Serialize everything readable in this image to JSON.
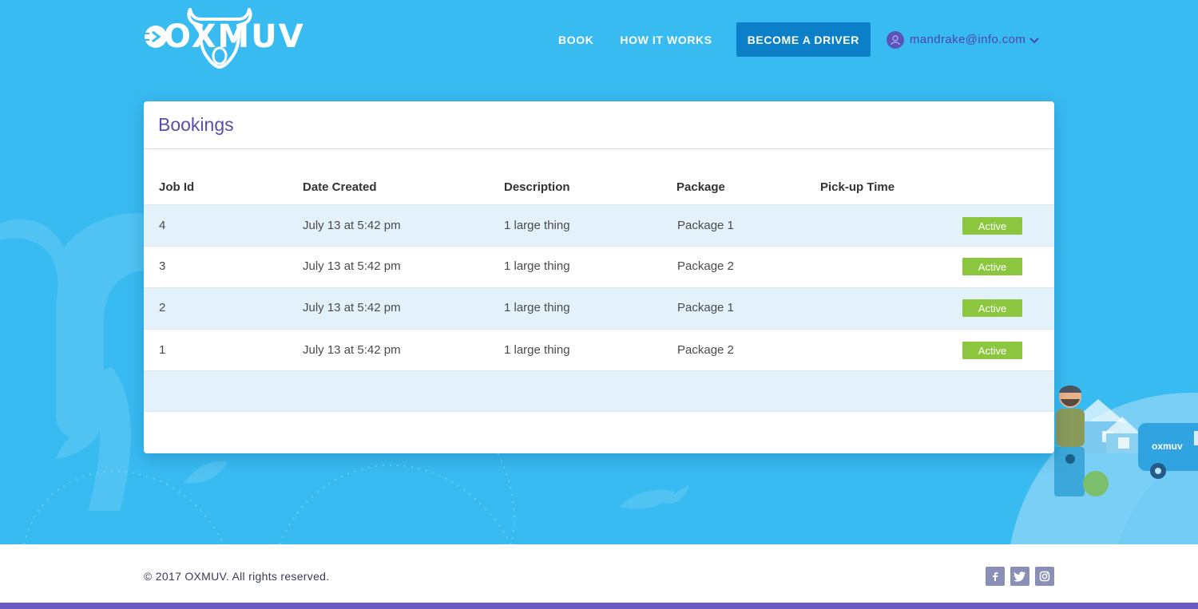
{
  "header": {
    "logo_text": "OXMUV",
    "nav": [
      "BOOK",
      "HOW IT WORKS"
    ],
    "driver_button": "BECOME A DRIVER",
    "user_email": "mandrake@info.com"
  },
  "bookings": {
    "title": "Bookings",
    "columns": [
      "Job Id",
      "Date Created",
      "Description",
      "Package",
      "Pick-up Time"
    ],
    "rows": [
      {
        "id": "4",
        "date": "July 13 at 5:42 pm",
        "description": "1 large thing",
        "package": "Package 1",
        "pickup": "",
        "status": "Active"
      },
      {
        "id": "3",
        "date": "July 13 at 5:42 pm",
        "description": "1 large thing",
        "package": "Package 2",
        "pickup": "",
        "status": "Active"
      },
      {
        "id": "2",
        "date": "July 13 at 5:42 pm",
        "description": "1 large thing",
        "package": "Package 1",
        "pickup": "",
        "status": "Active"
      },
      {
        "id": "1",
        "date": "July 13 at 5:42 pm",
        "description": "1 large thing",
        "package": "Package 2",
        "pickup": "",
        "status": "Active"
      }
    ]
  },
  "footer": {
    "copyright": "© 2017 OXMUV. All rights reserved.",
    "social_icons": [
      "facebook-icon",
      "twitter-icon",
      "instagram-icon"
    ]
  },
  "colors": {
    "background": "#38bbf1",
    "primary_button": "#0b80c9",
    "accent_purple": "#5a4ea8",
    "status_active": "#8cc63f",
    "row_alt": "#e3f1fa",
    "bottom_bar": "#6a5bc4"
  }
}
